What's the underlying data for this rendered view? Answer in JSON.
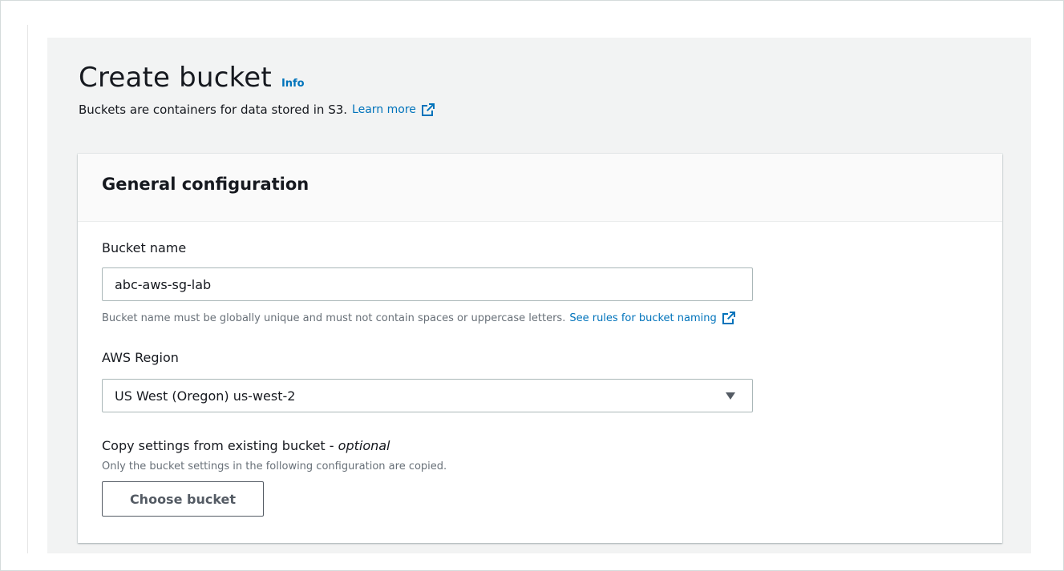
{
  "header": {
    "title": "Create bucket",
    "info_label": "Info",
    "description": "Buckets are containers for data stored in S3.",
    "learn_more_label": "Learn more"
  },
  "panel": {
    "title": "General configuration",
    "bucket_name": {
      "label": "Bucket name",
      "value": "abc-aws-sg-lab",
      "hint": "Bucket name must be globally unique and must not contain spaces or uppercase letters.",
      "rules_link": "See rules for bucket naming"
    },
    "region": {
      "label": "AWS Region",
      "selected": "US West (Oregon) us-west-2"
    },
    "copy_settings": {
      "label": "Copy settings from existing bucket - ",
      "optional": "optional",
      "hint": "Only the bucket settings in the following configuration are copied.",
      "button_label": "Choose bucket"
    }
  },
  "icons": {
    "external_link": "external-link-icon",
    "dropdown": "caret-down-icon"
  },
  "colors": {
    "link": "#0073bb",
    "background": "#f2f3f3",
    "panel_header": "#fafafa",
    "text": "#16191f",
    "muted_text": "#687078"
  }
}
